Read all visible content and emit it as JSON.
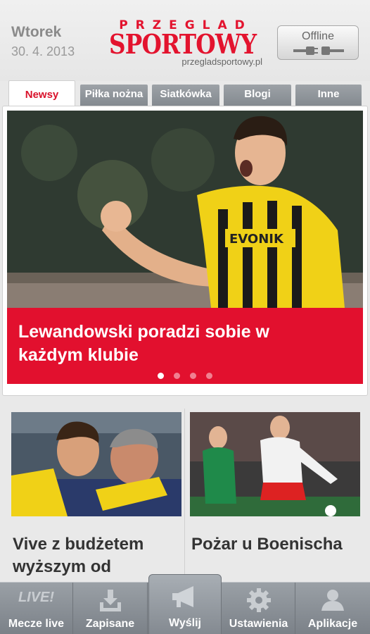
{
  "header": {
    "day": "Wtorek",
    "date": "30. 4. 2013",
    "logo_top": "PRZEGLAD",
    "logo_main": "SPORTOWY",
    "logo_url": "przegladsportowy.pl",
    "offline_label": "Offline",
    "offline_icon": "plug-icon"
  },
  "tabs": [
    {
      "label": "Newsy",
      "active": true
    },
    {
      "label": "Piłka nożna",
      "active": false
    },
    {
      "label": "Siatkówka",
      "active": false
    },
    {
      "label": "Blogi",
      "active": false
    },
    {
      "label": "Inne",
      "active": false
    }
  ],
  "hero": {
    "title": "Lewandowski poradzi sobie w każdym klubie",
    "jersey_text": "EVONIK",
    "slide_count": 4,
    "active_slide": 1,
    "caption_color": "#e2102e"
  },
  "news": [
    {
      "title": "Vive z budżetem wyższym od"
    },
    {
      "title": "Pożar u Boenischa"
    }
  ],
  "bottom_nav": [
    {
      "label": "Mecze live",
      "icon": "live-icon",
      "icon_text": "LIVE!"
    },
    {
      "label": "Zapisane",
      "icon": "download-tray-icon"
    },
    {
      "label": "Wyślij",
      "icon": "megaphone-icon"
    },
    {
      "label": "Ustawienia",
      "icon": "gear-icon"
    },
    {
      "label": "Aplikacje",
      "icon": "person-icon"
    }
  ],
  "colors": {
    "accent": "#e3132e",
    "tab_active_text": "#d9122b",
    "nav_bg": "#8a9097"
  }
}
